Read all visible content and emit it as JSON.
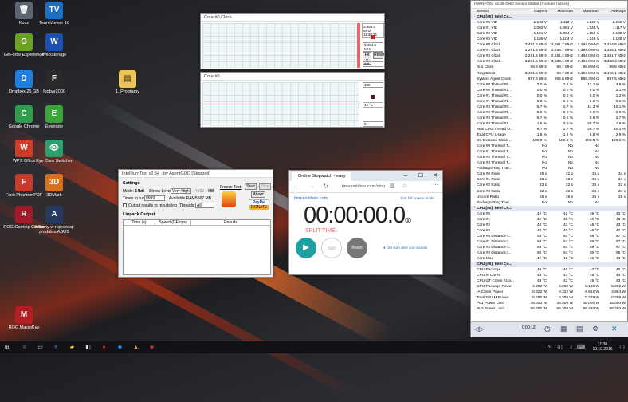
{
  "desktop": {
    "icons": [
      {
        "label": "Kosz",
        "color": "#5c6670",
        "glyph": "🗑"
      },
      {
        "label": "TeamViewer 10",
        "color": "#1c6fc4",
        "glyph": "TV"
      },
      {
        "label": "GeForce Experience",
        "color": "#6aa31f",
        "glyph": "G"
      },
      {
        "label": "WebStorage",
        "color": "#1c4fb4",
        "glyph": "W"
      },
      {
        "label": "Dropbox 25 GB",
        "color": "#1f7fe0",
        "glyph": "D"
      },
      {
        "label": "foobar2000",
        "color": "#2a2a2a",
        "glyph": "F"
      },
      {
        "label": "Google Chrome",
        "color": "#2f9d4b",
        "glyph": "C"
      },
      {
        "label": "Evernote",
        "color": "#3aa33a",
        "glyph": "E"
      },
      {
        "label": "WPS Office",
        "color": "#d23b2a",
        "glyph": "W"
      },
      {
        "label": "Eye Care Switcher",
        "color": "#2aa06a",
        "glyph": "👁"
      },
      {
        "label": "Foxit PhantomPDF",
        "color": "#c9392c",
        "glyph": "F"
      },
      {
        "label": "3DMark",
        "color": "#d9701d",
        "glyph": "3D"
      },
      {
        "label": "ROG Gaming Center",
        "color": "#a01a2a",
        "glyph": "R"
      },
      {
        "label": "Witamy w rejestracji produktu ASUS",
        "color": "#263a60",
        "glyph": "A"
      },
      {
        "label": "ROG MacroKey",
        "color": "#b41e24",
        "glyph": "M"
      }
    ],
    "folder_label": "1. Programy"
  },
  "clock_window": {
    "title": "Core #0 Clock",
    "val1": "3,494.0 MHz",
    "val2": "11:30:21",
    "val3": "3,494.5 MHz",
    "val4": "0.0",
    "btn_fit": "Fit y",
    "btn_reset": "Reset"
  },
  "temp_window": {
    "title": "Core #0",
    "val1": "100",
    "val2": "42 °C",
    "val3": "0"
  },
  "intelburn": {
    "title": "IntelBurnTest v2.54 - by AgentGOD [Stopped]",
    "settings": "Settings",
    "mode_label": "Mode:",
    "mode_value": "64bit",
    "stress_label": "Stress Level:",
    "stress_value": "Very High",
    "stress_mb": "4096",
    "mb": "MB",
    "times_label": "Times to run:",
    "times_value": "9999",
    "avail_label": "Available RAM:",
    "avail_value": "5567 MB",
    "output_label": "Output results to results.log",
    "threads_label": "Threads:",
    "threads_value": "All",
    "freeze": "Freeze Test:",
    "start": "Start",
    "stop": "Stop",
    "about": "About",
    "paypal": "PayPal",
    "donate": "DONATE",
    "linpack": "Linpack Output",
    "col_time": "Time (s)",
    "col_speed": "Speed (GFlops)",
    "col_results": "Results"
  },
  "stopwatch": {
    "title": "Online Stopwatch - easy",
    "url": "timeanddate.com/stop",
    "brand": "timeanddate.com",
    "fullscreen": "Exit full screen mode",
    "time": "00:00:00.0",
    "time_small": "00",
    "split_time": "SPLIT TIME",
    "split": "Split",
    "reset": "Reset",
    "alerts": "Set start alert and sounds"
  },
  "hwinfo": {
    "title": "HWiNFO64 v5.36-2960 Sensor Status [7 values hidden]",
    "headers": [
      "Sensor",
      "Current",
      "Minimum",
      "Maximum",
      "Average"
    ],
    "rows": [
      [
        "CPU [#0]: Intel Co...",
        "",
        "",
        "",
        ""
      ],
      [
        "Core #0 VID",
        "1.133 V",
        "1.113 V",
        "1.149 V",
        "1.136 V"
      ],
      [
        "Core #1 VID",
        "1.082 V",
        "1.081 V",
        "1.148 V",
        "1.117 V"
      ],
      [
        "Core #2 VID",
        "1.101 V",
        "1.094 V",
        "1.150 V",
        "1.130 V"
      ],
      [
        "Core #3 VID",
        "1.105 V",
        "1.104 V",
        "1.149 V",
        "1.128 V"
      ],
      [
        "Core #0 Clock",
        "3,491.5 MHz",
        "3,091.7 MHz",
        "3,494.0 MHz",
        "3,424.8 MHz"
      ],
      [
        "Core #1 Clock",
        "3,291.5 MHz",
        "3,288.7 MHz",
        "3,494.0 MHz",
        "3,355.1 MHz"
      ],
      [
        "Core #2 Clock",
        "3,291.5 MHz",
        "3,191.4 MHz",
        "3,494.0 MHz",
        "3,341.7 MHz"
      ],
      [
        "Core #3 Clock",
        "3,291.5 MHz",
        "3,189.1 MHz",
        "3,494.0 MHz",
        "3,358.3 MHz"
      ],
      [
        "Bus Clock",
        "99.8 MHz",
        "99.7 MHz",
        "99.8 MHz",
        "99.8 MHz"
      ],
      [
        "Ring Clock",
        "3,491.5 MHz",
        "99.7 MHz",
        "3,494.0 MHz",
        "3,456.1 MHz"
      ],
      [
        "System Agent Clock",
        "997.6 MHz",
        "996.6 MHz",
        "998.3 MHz",
        "997.5 MHz"
      ],
      [
        "Core #0 Thread #0...",
        "3.0 %",
        "2.2 %",
        "12.1 %",
        "4.8 %"
      ],
      [
        "Core #0 Thread #1...",
        "0.0 %",
        "0.0 %",
        "9.0 %",
        "2.1 %"
      ],
      [
        "Core #1 Thread #0...",
        "0.0 %",
        "0.0 %",
        "6.0 %",
        "1.2 %"
      ],
      [
        "Core #1 Thread #1...",
        "0.0 %",
        "0.0 %",
        "5.8 %",
        "0.6 %"
      ],
      [
        "Core #2 Thread #0...",
        "6.7 %",
        "2.7 %",
        "14.3 %",
        "10.1 %"
      ],
      [
        "Core #2 Thread #1...",
        "0.0 %",
        "0.0 %",
        "9.0 %",
        "0.9 %"
      ],
      [
        "Core #3 Thread #0...",
        "6.7 %",
        "0.0 %",
        "8.6 %",
        "2.7 %"
      ],
      [
        "Core #3 Thread #1...",
        "1.5 %",
        "0.0 %",
        "29.7 %",
        "1.6 %"
      ],
      [
        "Max CPU/Thread U...",
        "6.7 %",
        "2.7 %",
        "29.7 %",
        "10.1 %"
      ],
      [
        "Total CPU Usage",
        "1.6 %",
        "1.6 %",
        "6.8 %",
        "2.9 %"
      ],
      [
        "On-Demand Clock ...",
        "100.0 %",
        "100.0 %",
        "100.0 %",
        "100.0 %"
      ],
      [
        "Core #0 Thermal T...",
        "No",
        "No",
        "No",
        ""
      ],
      [
        "Core #1 Thermal T...",
        "No",
        "No",
        "No",
        ""
      ],
      [
        "Core #2 Thermal T...",
        "No",
        "No",
        "No",
        ""
      ],
      [
        "Core #3 Thermal T...",
        "No",
        "No",
        "No",
        ""
      ],
      [
        "Package/Ring Ther...",
        "No",
        "No",
        "No",
        ""
      ],
      [
        "Core #0 Ratio",
        "35 x",
        "31 x",
        "35 x",
        "34 x"
      ],
      [
        "Core #1 Ratio",
        "33 x",
        "33 x",
        "35 x",
        "34 x"
      ],
      [
        "Core #2 Ratio",
        "33 x",
        "32 x",
        "35 x",
        "33 x"
      ],
      [
        "Core #3 Ratio",
        "33 x",
        "32 x",
        "35 x",
        "34 x"
      ],
      [
        "Uncore Ratio",
        "35 x",
        "35 x",
        "35 x",
        "35 x"
      ],
      [
        "Package/Ring Ther...",
        "No",
        "No",
        "No",
        ""
      ],
      [
        "CPU [#0]: Intel Co...",
        "",
        "",
        "",
        ""
      ],
      [
        "Core #0",
        "42 °C",
        "42 °C",
        "46 °C",
        "43 °C"
      ],
      [
        "Core #1",
        "42 °C",
        "41 °C",
        "46 °C",
        "43 °C"
      ],
      [
        "Core #2",
        "42 °C",
        "41 °C",
        "46 °C",
        "43 °C"
      ],
      [
        "Core #3",
        "40 °C",
        "40 °C",
        "46 °C",
        "42 °C"
      ],
      [
        "Core #0 Distance t...",
        "58 °C",
        "54 °C",
        "58 °C",
        "57 °C"
      ],
      [
        "Core #1 Distance t...",
        "58 °C",
        "54 °C",
        "59 °C",
        "57 °C"
      ],
      [
        "Core #2 Distance t...",
        "58 °C",
        "54 °C",
        "59 °C",
        "57 °C"
      ],
      [
        "Core #3 Distance t...",
        "60 °C",
        "54 °C",
        "60 °C",
        "58 °C"
      ],
      [
        "Core Max",
        "42 °C",
        "42 °C",
        "46 °C",
        "44 °C"
      ],
      [
        "CPU [#0]: Intel Co...",
        "",
        "",
        "",
        ""
      ],
      [
        "CPU Package",
        "46 °C",
        "46 °C",
        "47 °C",
        "46 °C"
      ],
      [
        "CPU IA Cores",
        "43 °C",
        "43 °C",
        "46 °C",
        "44 °C"
      ],
      [
        "CPU GT Cores (Gra...",
        "43 °C",
        "42 °C",
        "45 °C",
        "43 °C"
      ],
      [
        "CPU Package Power",
        "4.292 W",
        "4.292 W",
        "8.148 W",
        "5.408 W"
      ],
      [
        "IA Cores Power",
        "0.322 W",
        "0.322 W",
        "6.912 W",
        "3.983 W"
      ],
      [
        "Total DRAM Power",
        "0.290 W",
        "0.290 W",
        "0.339 W",
        "0.309 W"
      ],
      [
        "PL1 Power Limit",
        "45.000 W",
        "45.000 W",
        "45.000 W",
        "45.000 W"
      ],
      [
        "PL2 Power Limit",
        "56.250 W",
        "56.250 W",
        "56.250 W",
        "56.250 W"
      ]
    ],
    "elapsed": "0:00:12"
  },
  "taskbar": {
    "time": "11:30",
    "date": "10.10.2016"
  }
}
